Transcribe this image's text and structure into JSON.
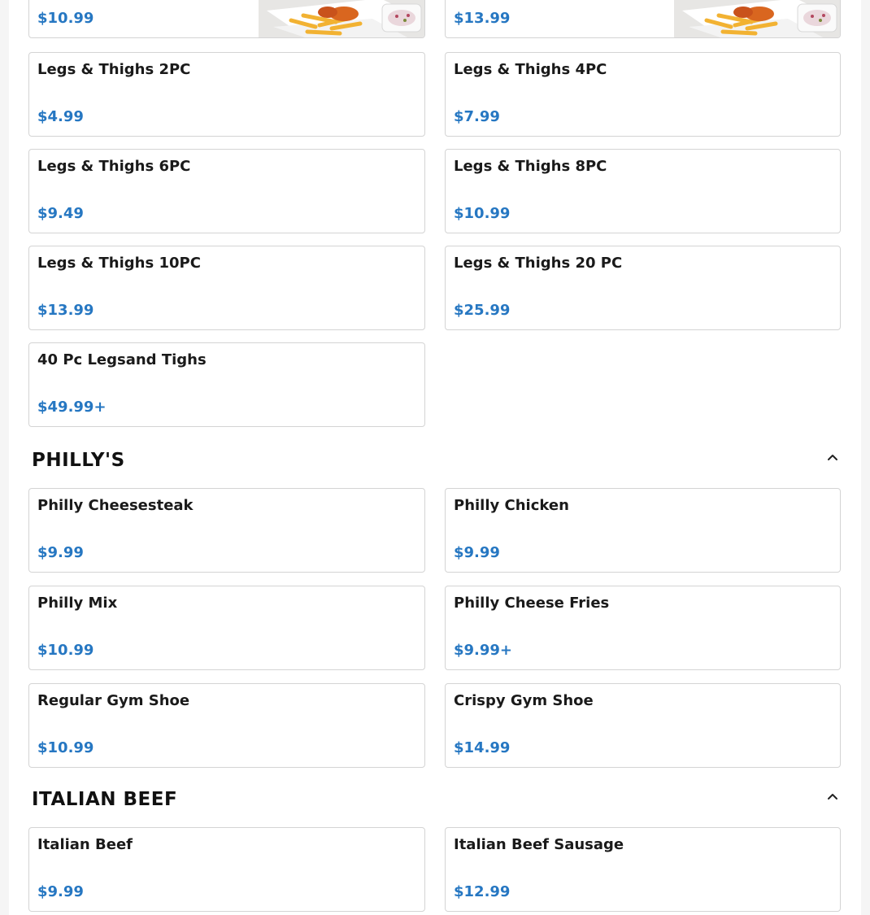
{
  "top_partial_items": [
    {
      "price": "$10.99",
      "image": "wings-and-fries-photo"
    },
    {
      "price": "$13.99",
      "image": "wings-and-fries-photo"
    }
  ],
  "legs_thighs_items": [
    {
      "name": "Legs & Thighs 2PC",
      "price": "$4.99"
    },
    {
      "name": "Legs & Thighs 4PC",
      "price": "$7.99"
    },
    {
      "name": "Legs & Thighs 6PC",
      "price": "$9.49"
    },
    {
      "name": "Legs & Thighs 8PC",
      "price": "$10.99"
    },
    {
      "name": "Legs & Thighs 10PC",
      "price": "$13.99"
    },
    {
      "name": "Legs & Thighs 20 PC",
      "price": "$25.99"
    },
    {
      "name": "40 Pc Legsand Tighs",
      "price": "$49.99+"
    }
  ],
  "sections": [
    {
      "title": "PHILLY'S",
      "collapse_icon": "chevron-up-icon",
      "items": [
        {
          "name": "Philly Cheesesteak",
          "price": "$9.99"
        },
        {
          "name": "Philly Chicken",
          "price": "$9.99"
        },
        {
          "name": "Philly Mix",
          "price": "$10.99"
        },
        {
          "name": "Philly Cheese Fries",
          "price": "$9.99+"
        },
        {
          "name": "Regular Gym Shoe",
          "price": "$10.99"
        },
        {
          "name": "Crispy Gym Shoe",
          "price": "$14.99"
        }
      ]
    },
    {
      "title": "ITALIAN BEEF",
      "collapse_icon": "chevron-up-icon",
      "items": [
        {
          "name": "Italian Beef",
          "price": "$9.99"
        },
        {
          "name": "Italian Beef Sausage",
          "price": "$12.99"
        }
      ]
    }
  ],
  "colors": {
    "price": "#2677c2",
    "card_border": "#d4d4d4",
    "title": "#111111"
  }
}
